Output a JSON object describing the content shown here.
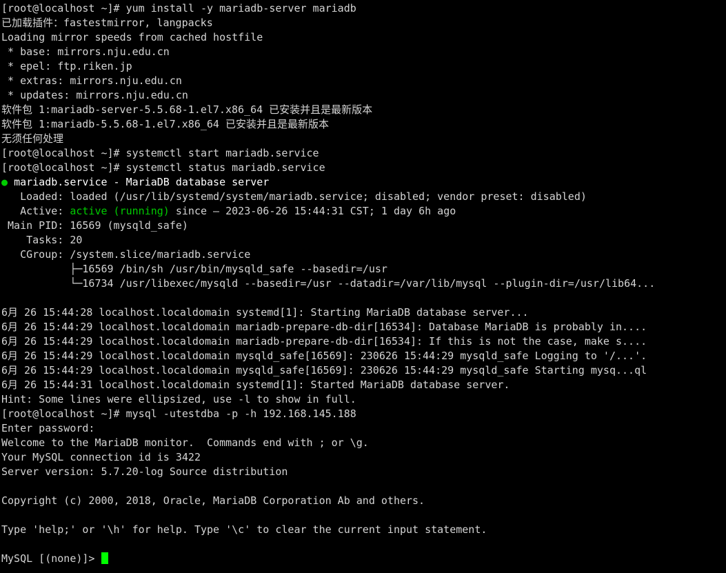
{
  "terminal": {
    "background_color": "#000000",
    "foreground_color": "#d4d4d4",
    "accent_green": "#00cc00",
    "cursor_color": "#00ff00",
    "prompt": "[root@localhost ~]#",
    "cursor_prompt": "MySQL [(none)]> ",
    "lines": [
      {
        "id": "l01",
        "text": "[root@localhost ~]# yum install -y mariadb-server mariadb"
      },
      {
        "id": "l02",
        "text": "已加载插件：fastestmirror, langpacks"
      },
      {
        "id": "l03",
        "text": "Loading mirror speeds from cached hostfile"
      },
      {
        "id": "l04",
        "text": " * base: mirrors.nju.edu.cn"
      },
      {
        "id": "l05",
        "text": " * epel: ftp.riken.jp"
      },
      {
        "id": "l06",
        "text": " * extras: mirrors.nju.edu.cn"
      },
      {
        "id": "l07",
        "text": " * updates: mirrors.nju.edu.cn"
      },
      {
        "id": "l08",
        "text": "软件包 1:mariadb-server-5.5.68-1.el7.x86_64 已安装并且是最新版本"
      },
      {
        "id": "l09",
        "text": "软件包 1:mariadb-5.5.68-1.el7.x86_64 已安装并且是最新版本"
      },
      {
        "id": "l10",
        "text": "无须任何处理"
      },
      {
        "id": "l11",
        "text": "[root@localhost ~]# systemctl start mariadb.service"
      },
      {
        "id": "l12",
        "text": "[root@localhost ~]# systemctl status mariadb.service"
      },
      {
        "id": "l13",
        "text": "mariadb.service - MariaDB database server",
        "dot": "●"
      },
      {
        "id": "l14",
        "text": "   Loaded: loaded (/usr/lib/systemd/system/mariadb.service; disabled; vendor preset: disabled)"
      },
      {
        "id": "l15",
        "prefix": "   Active: ",
        "green": "active (running)",
        "suffix": " since — 2023-06-26 15:44:31 CST; 1 day 6h ago"
      },
      {
        "id": "l16",
        "text": " Main PID: 16569 (mysqld_safe)"
      },
      {
        "id": "l17",
        "text": "    Tasks: 20"
      },
      {
        "id": "l18",
        "text": "   CGroup: /system.slice/mariadb.service"
      },
      {
        "id": "l19",
        "text": "           ├─16569 /bin/sh /usr/bin/mysqld_safe --basedir=/usr"
      },
      {
        "id": "l20",
        "text": "           └─16734 /usr/libexec/mysqld --basedir=/usr --datadir=/var/lib/mysql --plugin-dir=/usr/lib64..."
      },
      {
        "id": "l21",
        "text": ""
      },
      {
        "id": "l22",
        "text": "6月 26 15:44:28 localhost.localdomain systemd[1]: Starting MariaDB database server..."
      },
      {
        "id": "l23",
        "text": "6月 26 15:44:29 localhost.localdomain mariadb-prepare-db-dir[16534]: Database MariaDB is probably in...."
      },
      {
        "id": "l24",
        "text": "6月 26 15:44:29 localhost.localdomain mariadb-prepare-db-dir[16534]: If this is not the case, make s...."
      },
      {
        "id": "l25",
        "text": "6月 26 15:44:29 localhost.localdomain mysqld_safe[16569]: 230626 15:44:29 mysqld_safe Logging to '/...'."
      },
      {
        "id": "l26",
        "text": "6月 26 15:44:29 localhost.localdomain mysqld_safe[16569]: 230626 15:44:29 mysqld_safe Starting mysq...ql"
      },
      {
        "id": "l27",
        "text": "6月 26 15:44:31 localhost.localdomain systemd[1]: Started MariaDB database server."
      },
      {
        "id": "l28",
        "text": "Hint: Some lines were ellipsized, use -l to show in full."
      },
      {
        "id": "l29",
        "text": "[root@localhost ~]# mysql -utestdba -p -h 192.168.145.188"
      },
      {
        "id": "l30",
        "text": "Enter password:"
      },
      {
        "id": "l31",
        "text": "Welcome to the MariaDB monitor.  Commands end with ; or \\g."
      },
      {
        "id": "l32",
        "text": "Your MySQL connection id is 3422"
      },
      {
        "id": "l33",
        "text": "Server version: 5.7.20-log Source distribution"
      },
      {
        "id": "l34",
        "text": ""
      },
      {
        "id": "l35",
        "text": "Copyright (c) 2000, 2018, Oracle, MariaDB Corporation Ab and others."
      },
      {
        "id": "l36",
        "text": ""
      },
      {
        "id": "l37",
        "text": "Type 'help;' or '\\h' for help. Type '\\c' to clear the current input statement."
      },
      {
        "id": "l38",
        "text": ""
      },
      {
        "id": "l39",
        "prompt": "MySQL [(none)]> ",
        "cursor": true
      }
    ]
  }
}
